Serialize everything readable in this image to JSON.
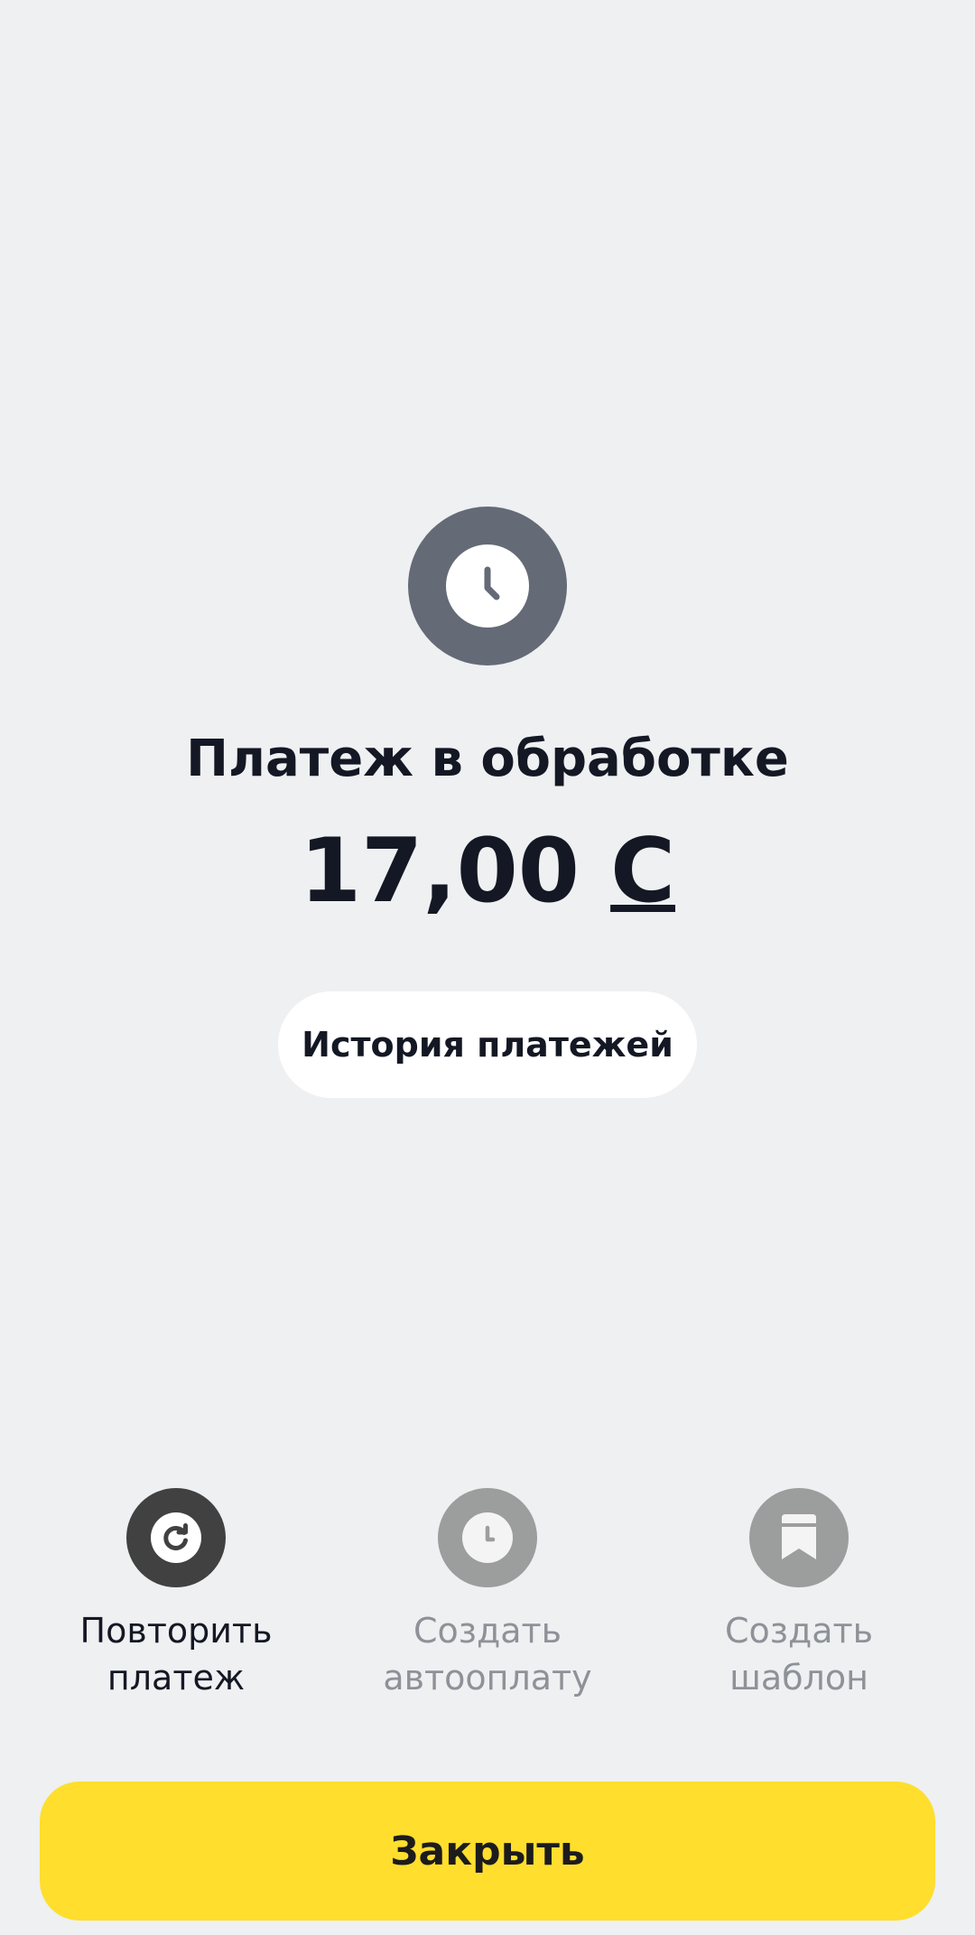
{
  "status": {
    "icon": "clock-icon",
    "title": "Платеж в обработке"
  },
  "payment": {
    "amount": "17,00",
    "currency_symbol": "С"
  },
  "history_button": {
    "label": "История платежей"
  },
  "actions": [
    {
      "icon": "repeat-icon",
      "label": "Повторить\nплатеж",
      "enabled": true
    },
    {
      "icon": "clock-icon",
      "label": "Создать\nавтооплату",
      "enabled": false
    },
    {
      "icon": "bookmark-icon",
      "label": "Создать\nшаблон",
      "enabled": false
    }
  ],
  "close_button": {
    "label": "Закрыть"
  },
  "colors": {
    "background": "#eef0f2",
    "status_circle": "#646a76",
    "primary_button": "#ffde2e",
    "active_action": "#414141",
    "disabled_action": "#9c9d9d",
    "text_primary": "#141824",
    "text_disabled": "#8e9298"
  }
}
